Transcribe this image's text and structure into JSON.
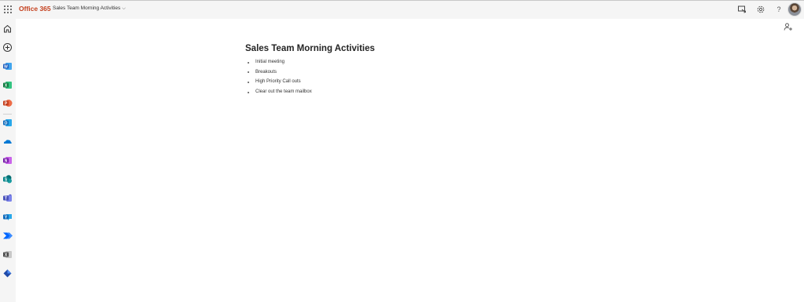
{
  "header": {
    "app_name": "Office 365",
    "document_title": "Sales Team Morning Activities",
    "brand_color": "#c43e1c",
    "icons": [
      "app-launcher-icon",
      "present-icon",
      "settings-icon",
      "help-icon",
      "avatar"
    ],
    "help_glyph": "?"
  },
  "rail": {
    "items": [
      {
        "name": "home-icon"
      },
      {
        "name": "create-icon"
      },
      {
        "name": "word-icon",
        "letter": "W",
        "color": "#185abd"
      },
      {
        "name": "excel-icon",
        "letter": "X",
        "color": "#107c41"
      },
      {
        "name": "powerpoint-icon",
        "letter": "P",
        "color": "#c43e1c"
      },
      {
        "name": "outlook-icon",
        "letter": "O",
        "color": "#0f6cbd"
      },
      {
        "name": "onedrive-icon",
        "color": "#0078d4"
      },
      {
        "name": "onenote-icon",
        "letter": "N",
        "color": "#7719aa"
      },
      {
        "name": "sharepoint-icon",
        "letter": "S",
        "color": "#038387"
      },
      {
        "name": "teams-icon",
        "letter": "T",
        "color": "#5059c9"
      },
      {
        "name": "viva-engage-icon",
        "letter": "Y",
        "color": "#0f6cbd"
      },
      {
        "name": "power-automate-icon",
        "color": "#0066ff"
      },
      {
        "name": "sway-icon",
        "letter": "X",
        "color": "#4a4a4a"
      },
      {
        "name": "defender-icon",
        "color": "#1f4aa8"
      }
    ]
  },
  "document": {
    "heading": "Sales Team Morning Activities",
    "bullets": [
      "Initial meeting",
      "Breakouts",
      "High Priority Call outs",
      "Clear out the team mailbox"
    ]
  }
}
